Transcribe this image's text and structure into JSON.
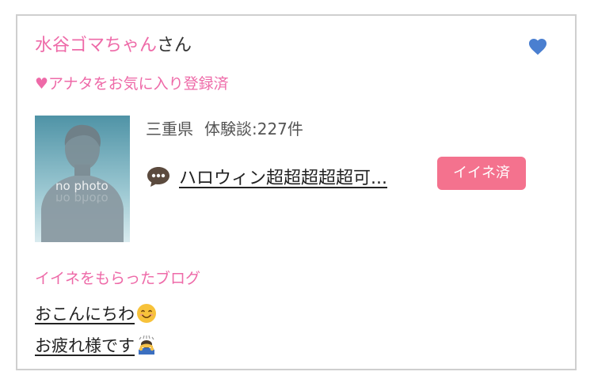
{
  "header": {
    "username": "水谷ゴマちゃん",
    "honorific": "さん",
    "favorite_icon": "heart-icon",
    "favorite_color": "#4a7fd0"
  },
  "favorite_status": "♥アナタをお気に入り登録済",
  "profile": {
    "avatar_placeholder_text": "no photo",
    "prefecture": "三重県",
    "experience_count": "体験談:227件"
  },
  "latest_blog": {
    "icon": "speech-bubble-icon",
    "title": "ハロウィン超超超超超可...",
    "iine_label": "イイネ済"
  },
  "liked_blogs": {
    "section_title": "イイネをもらったブログ",
    "items": [
      {
        "title": "おこんにちわ",
        "emoji": "smiling-face-icon"
      },
      {
        "title": "お疲れ様です",
        "emoji": "bowing-person-icon"
      }
    ]
  },
  "colors": {
    "accent_pink": "#ee6aa8",
    "badge_pink": "#f4728e",
    "border": "#cfcfcf"
  }
}
